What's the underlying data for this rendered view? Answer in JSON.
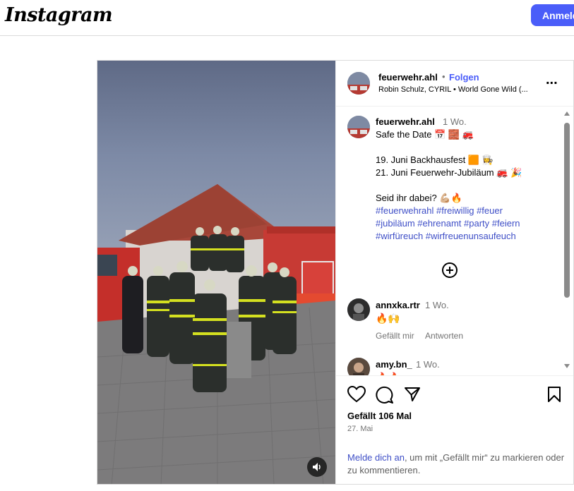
{
  "topbar": {
    "logo": "Instagram",
    "login_button": "Anmelden"
  },
  "post": {
    "header": {
      "username": "feuerwehr.ahl",
      "separator": "•",
      "follow_label": "Folgen",
      "music": "Robin Schulz, CYRIL • World Gone Wild (...",
      "more_label": "..."
    },
    "caption": {
      "username": "feuerwehr.ahl",
      "time": "1 Wo.",
      "lines": [
        "Safe the Date 📅 🧱 🚒",
        "",
        "19. Juni Backhausfest 🟧 👩‍🍳",
        "21. Juni Feuerwehr-Jubiläum 🚒 🎉",
        "",
        "Seid ihr dabei? 💪🏼🔥"
      ],
      "hashtags": [
        "#feuerwehrahl #freiwillig #feuer",
        "#jubiläum #ehrenamt #party #feiern",
        "#wirfüreuch #wirfreuenunsaufeuch"
      ]
    },
    "comments": [
      {
        "username": "annxka.rtr",
        "time": "1 Wo.",
        "text": "🔥🙌",
        "likes_label": "Gefällt mir",
        "reply_label": "Antworten"
      },
      {
        "username": "amy.bn_",
        "time": "1 Wo.",
        "text": "🔥🔥"
      }
    ],
    "likes": "Gefällt 106 Mal",
    "date": "27. Mai",
    "login_link": "Melde dich an",
    "login_rest": ", um mit „Gefällt mir“ zu markieren oder zu kommentieren."
  },
  "icons": {
    "heart": "heart-icon",
    "comment": "comment-icon",
    "share": "share-icon",
    "bookmark": "bookmark-icon",
    "sound": "speaker-icon",
    "plus": "plus-circle-icon",
    "more": "more-icon"
  },
  "colors": {
    "accent": "#4a5df9",
    "link": "#3f4fc7",
    "muted": "#737373"
  }
}
